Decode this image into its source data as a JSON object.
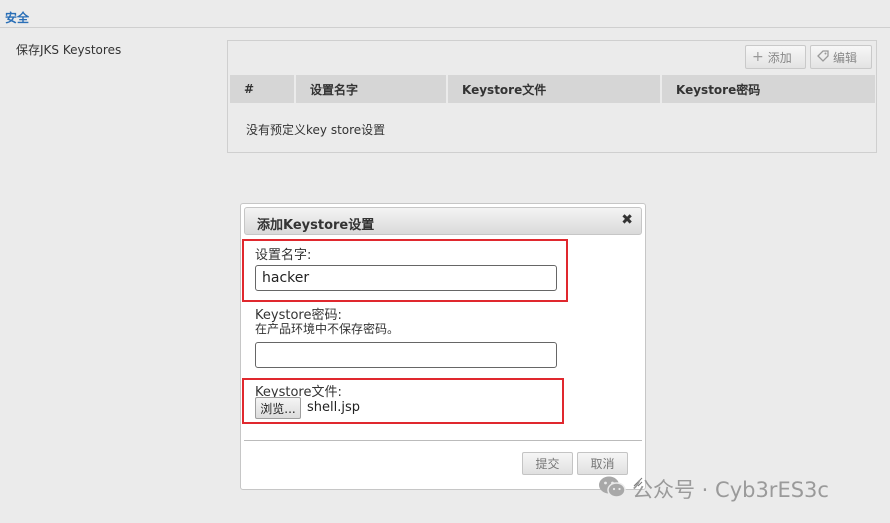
{
  "section": {
    "title": "安全"
  },
  "field": {
    "label": "保存JKS Keystores"
  },
  "toolbar": {
    "add_label": "添加",
    "edit_label": "编辑"
  },
  "table": {
    "columns": [
      "#",
      "设置名字",
      "Keystore文件",
      "Keystore密码"
    ],
    "empty_text": "没有预定义key store设置"
  },
  "dialog": {
    "title": "添加Keystore设置",
    "close_glyph": "✖",
    "name_label": "设置名字:",
    "name_value": "hacker",
    "password_label": "Keystore密码:",
    "password_hint": "在产品环境中不保存密码。",
    "password_value": "",
    "file_label": "Keystore文件:",
    "browse_label": "浏览...",
    "file_name": "shell.jsp",
    "submit_label": "提交",
    "cancel_label": "取消"
  },
  "watermark": {
    "text": "公众号 · Cyb3rES3c"
  },
  "colors": {
    "highlight": "#e0282e",
    "section_title": "#2a6fb7"
  },
  "icons": [
    "plus-icon",
    "tag-icon",
    "close-icon",
    "resize-grip-icon",
    "wechat-icon"
  ]
}
